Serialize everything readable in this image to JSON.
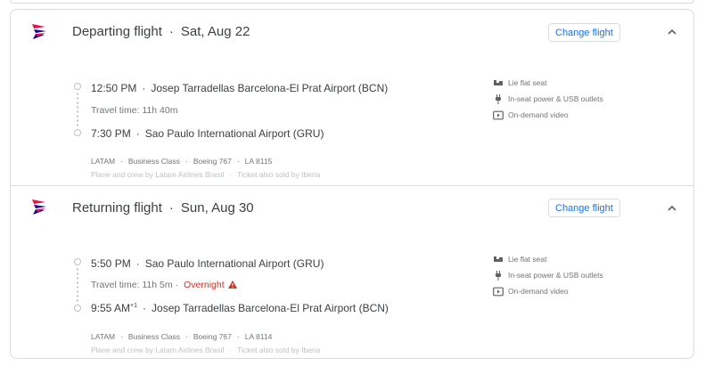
{
  "departing": {
    "title": "Departing flight",
    "date": "Sat, Aug 22",
    "change_label": "Change flight",
    "depart_time": "12:50 PM",
    "depart_airport": "Josep Tarradellas Barcelona-El Prat Airport (BCN)",
    "travel_time": "Travel time: 11h 40m",
    "arrive_time": "7:30 PM",
    "arrive_airport": "Sao Paulo International Airport (GRU)",
    "airline": "LATAM",
    "cabin": "Business Class",
    "aircraft": "Boeing 767",
    "flight_number": "LA 8115",
    "operated_by": "Plane and crew by Latam Airlines Brasil",
    "sold_by": "Ticket also sold by Iberia",
    "amenities": [
      "Lie flat seat",
      "In-seat power & USB outlets",
      "On-demand video"
    ]
  },
  "returning": {
    "title": "Returning flight",
    "date": "Sun, Aug 30",
    "change_label": "Change flight",
    "depart_time": "5:50 PM",
    "depart_airport": "Sao Paulo International Airport (GRU)",
    "travel_time": "Travel time: 11h 5m",
    "overnight": "Overnight",
    "arrive_time": "9:55 AM",
    "arrive_day_offset": "+1",
    "arrive_airport": "Josep Tarradellas Barcelona-El Prat Airport (BCN)",
    "airline": "LATAM",
    "cabin": "Business Class",
    "aircraft": "Boeing 767",
    "flight_number": "LA 8114",
    "operated_by": "Plane and crew by Latam Airlines Brasil",
    "sold_by": "Ticket also sold by Iberia",
    "amenities": [
      "Lie flat seat",
      "In-seat power & USB outlets",
      "On-demand video"
    ]
  },
  "colors": {
    "accent": "#1a73e8",
    "warning": "#d93025",
    "latam_blue": "#1b0088",
    "latam_red": "#e8114b"
  },
  "icons": {
    "airline": "latam-logo",
    "seat": "seat-icon",
    "power": "power-plug-icon",
    "video": "video-icon",
    "collapse": "chevron-up-icon",
    "warning": "warning-icon"
  }
}
